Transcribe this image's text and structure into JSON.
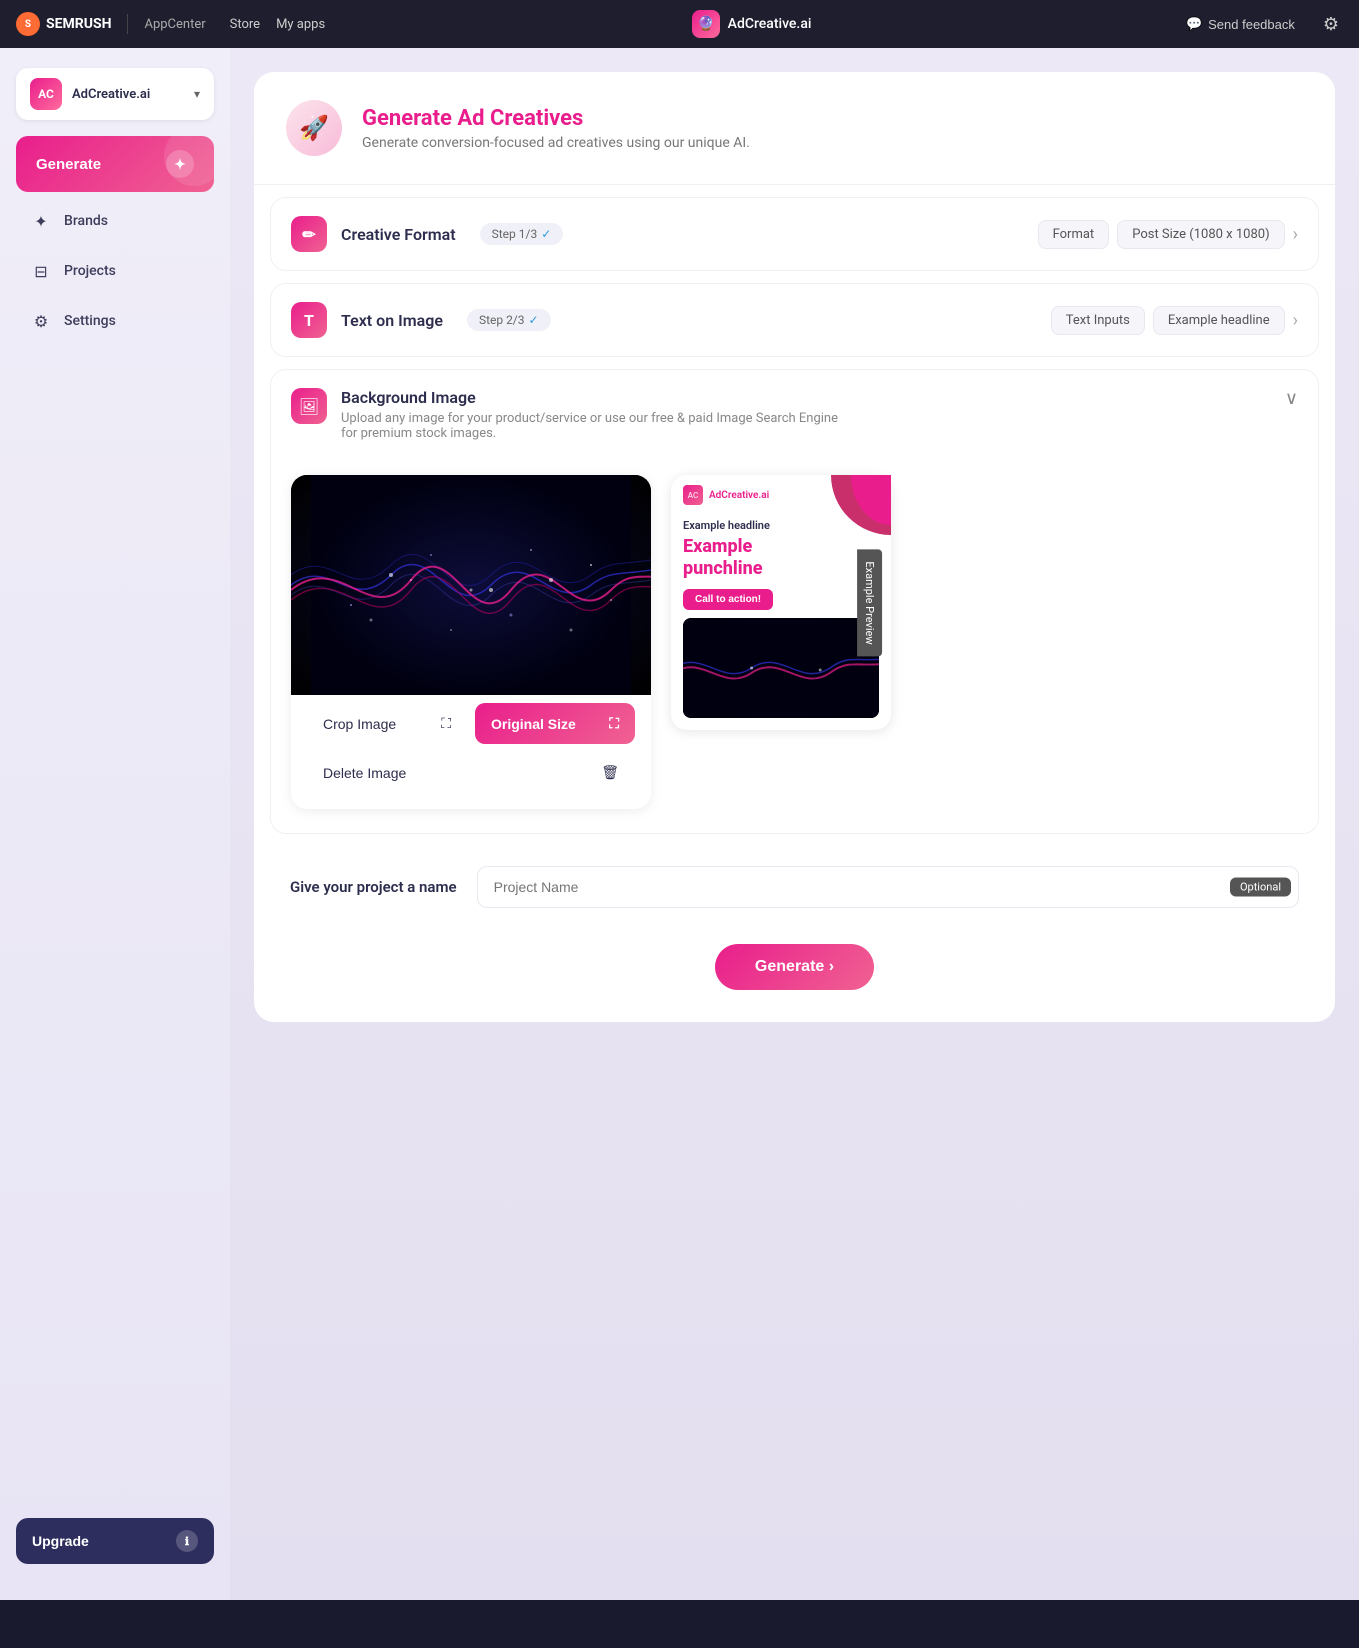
{
  "topnav": {
    "brand": "SEMRUSH",
    "divider": "|",
    "appcenter": "AppCenter",
    "links": [
      "Store",
      "My apps"
    ],
    "app_icon": "🔮",
    "app_name": "AdCreative.ai",
    "send_feedback": "Send feedback",
    "settings_icon": "⚙"
  },
  "sidebar": {
    "brand_name": "AdCreative.ai",
    "chevron": "▾",
    "generate_label": "Generate",
    "nav_items": [
      {
        "id": "brands",
        "icon": "✦",
        "label": "Brands"
      },
      {
        "id": "projects",
        "icon": "⊟",
        "label": "Projects"
      },
      {
        "id": "settings",
        "icon": "⚙",
        "label": "Settings"
      }
    ],
    "upgrade_label": "Upgrade",
    "upgrade_icon": "ℹ"
  },
  "page": {
    "header": {
      "icon": "🚀",
      "title": "Generate Ad Creatives",
      "description": "Generate conversion-focused ad creatives using our unique AI."
    },
    "step1": {
      "icon": "✏",
      "title": "Creative Format",
      "badge": "Step 1/3",
      "check": "✓",
      "tag1": "Format",
      "tag2": "Post Size (1080 x 1080)",
      "chevron": "›"
    },
    "step2": {
      "icon": "T",
      "title": "Text on Image",
      "badge": "Step 2/3",
      "check": "✓",
      "tag1": "Text Inputs",
      "tag2": "Example headline",
      "chevron": "›"
    },
    "background": {
      "icon": "🖼",
      "title": "Background Image",
      "description": "Upload any image for your product/service or use our free & paid Image Search Engine for premium stock images.",
      "collapse_icon": "∨"
    },
    "image_actions": {
      "crop_label": "Crop Image",
      "crop_icon": "⛶",
      "original_label": "Original Size",
      "original_icon": "⛶",
      "delete_label": "Delete Image",
      "delete_icon": "🗑"
    },
    "preview": {
      "brand_name": "AdCreative.ai",
      "headline": "Example headline",
      "punchline_line1": "Example",
      "punchline_line2": "punchline",
      "cta": "Call to action!",
      "tab_label": "Example Preview"
    },
    "project_name": {
      "label": "Give your project a name",
      "placeholder": "Project Name",
      "optional_badge": "Optional"
    },
    "generate_button": "Generate ›"
  }
}
